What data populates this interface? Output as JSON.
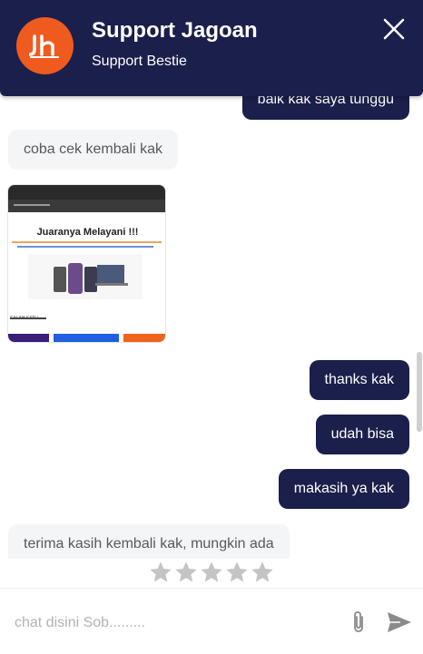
{
  "header": {
    "title": "Support Jagoan",
    "subtitle": "Support Bestie",
    "logo_text": "Jh"
  },
  "messages": [
    {
      "from": "user",
      "text": "baik kak saya tunggu"
    },
    {
      "from": "agent",
      "text": "coba cek kembali kak"
    },
    {
      "from": "agent",
      "type": "image",
      "caption": "Juaranya Melayani !!!",
      "footer_text": "SALAH SATU"
    },
    {
      "from": "user",
      "text": "thanks kak"
    },
    {
      "from": "user",
      "text": "udah bisa"
    },
    {
      "from": "user",
      "text": "makasih ya kak"
    },
    {
      "from": "agent",
      "text": "terima kasih kembali kak, mungkin ada"
    }
  ],
  "rating": {
    "stars": 5,
    "selected": 0
  },
  "composer": {
    "placeholder": "chat disini Sob.........",
    "value": ""
  },
  "colors": {
    "navy": "#1b1f4b",
    "brand_orange": "#ef5b1f",
    "agent_bubble": "#f4f5f6"
  },
  "icons": {
    "close": "close-icon",
    "attach": "paperclip-icon",
    "send": "send-icon",
    "star": "star-icon"
  }
}
